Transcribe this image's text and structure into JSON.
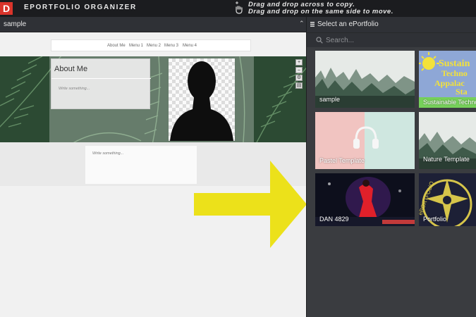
{
  "app": {
    "logo_letter": "D",
    "title": "EPORTFOLIO ORGANIZER",
    "hint_line1": "Drag and drop across to copy.",
    "hint_line2": "Drag and drop on the same side to move."
  },
  "left": {
    "title": "sample",
    "caret": "⌃",
    "nav": [
      "About Me",
      "Menu 1",
      "Menu 2",
      "Menu 3",
      "Menu 4"
    ],
    "about_title": "About Me",
    "about_placeholder": "Write something...",
    "write_placeholder": "Write something...",
    "tools": [
      "+",
      "–",
      "⚙",
      "▤"
    ]
  },
  "right": {
    "title": "Select an ePortfolio",
    "search_placeholder": "Search...",
    "cards": [
      {
        "label": "sample"
      },
      {
        "label": "Sustainable Techno",
        "image_text": [
          "Sustain",
          "Techno",
          "Appalac",
          "Sta"
        ]
      },
      {
        "label": "Pastel Template"
      },
      {
        "label": "Nature Template"
      },
      {
        "label": "DAN 4829"
      },
      {
        "label": "Portfolio",
        "image_text": "ePORTFOLIO"
      }
    ]
  },
  "colors": {
    "accent_red": "#d9342b",
    "arrow_yellow": "#ece11a",
    "sustain_green": "#76d05a"
  }
}
